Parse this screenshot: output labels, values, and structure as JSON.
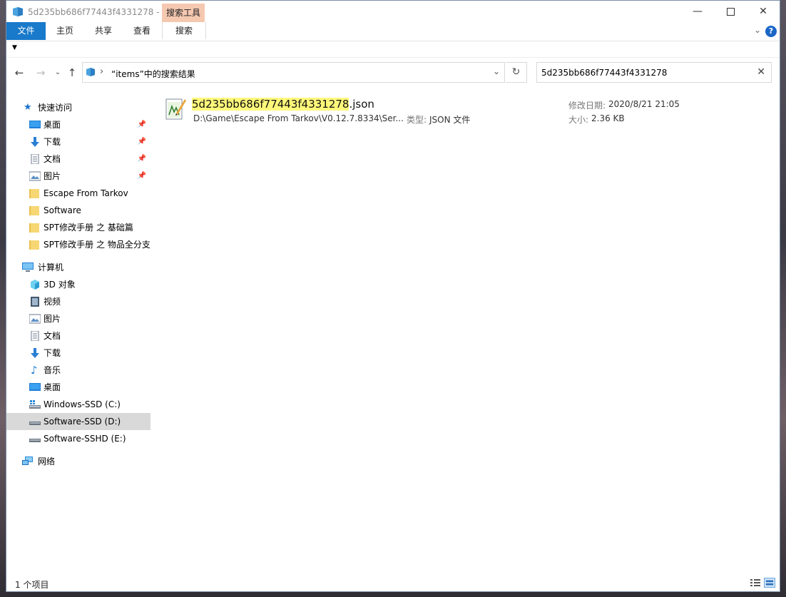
{
  "window": {
    "title": "5d235bb686f77443f4331278 - ...",
    "context_tab_header": "搜索工具"
  },
  "ribbon": {
    "tabs": [
      "文件",
      "主页",
      "共享",
      "查看",
      "搜索"
    ]
  },
  "address": {
    "path_label": "“items”中的搜索结果",
    "search_value": "5d235bb686f77443f4331278"
  },
  "sidebar": {
    "quick_access": "快速访问",
    "pinned": [
      "桌面",
      "下载",
      "文档",
      "图片"
    ],
    "folders": [
      "Escape From Tarkov",
      "Software",
      "SPT修改手册 之 基础篇",
      "SPT修改手册 之 物品全分支"
    ],
    "this_pc": "计算机",
    "pc_items": [
      "3D 对象",
      "视频",
      "图片",
      "文档",
      "下载",
      "音乐",
      "桌面"
    ],
    "drives": [
      "Windows-SSD (C:)",
      "Software-SSD (D:)",
      "Software-SSHD (E:)"
    ],
    "network": "网络"
  },
  "result": {
    "name_highlight": "5d235bb686f77443f4331278",
    "name_ext": ".json",
    "path": "D:\\Game\\Escape From Tarkov\\V0.12.7.8334\\Ser...",
    "type_label": "类型:",
    "type_value": "JSON 文件",
    "date_label": "修改日期:",
    "date_value": "2020/8/21 21:05",
    "size_label": "大小:",
    "size_value": "2.36 KB"
  },
  "status": {
    "count": "1 个项目"
  },
  "colors": {
    "accent": "#1979ca",
    "context_tab": "#f5c8b0",
    "highlight": "#fff87a",
    "selected_row": "#d9d9d9"
  }
}
